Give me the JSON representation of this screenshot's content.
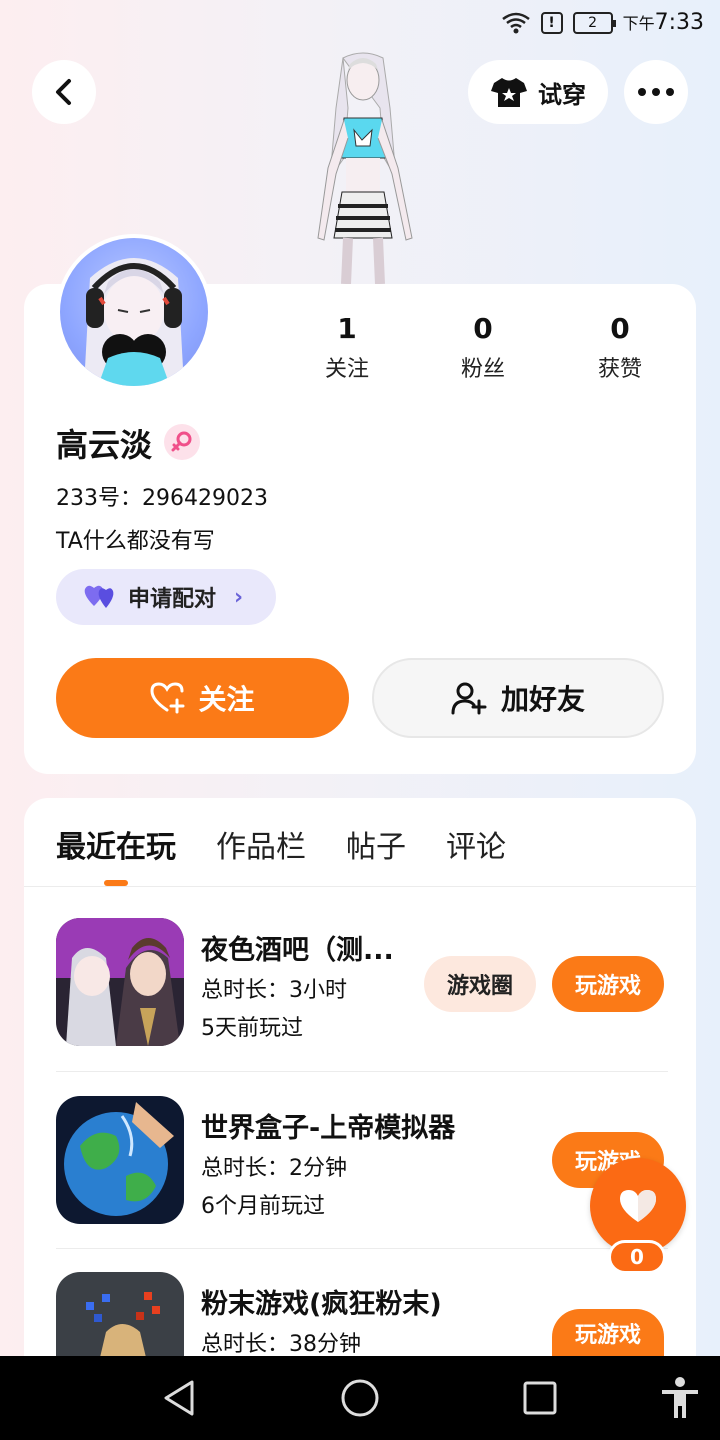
{
  "status_bar": {
    "time_prefix": "下午",
    "time": "7:33",
    "battery": "2"
  },
  "header": {
    "tryon_label": "试穿"
  },
  "profile": {
    "stats": [
      {
        "value": "1",
        "label": "关注"
      },
      {
        "value": "0",
        "label": "粉丝"
      },
      {
        "value": "0",
        "label": "获赞"
      }
    ],
    "username": "高云淡",
    "uid": "233号：296429023",
    "bio": "TA什么都没有写",
    "match_label": "申请配对",
    "follow_label": "关注",
    "add_friend_label": "加好友"
  },
  "tabs": [
    {
      "label": "最近在玩"
    },
    {
      "label": "作品栏"
    },
    {
      "label": "帖子"
    },
    {
      "label": "评论"
    }
  ],
  "games": [
    {
      "title": "夜色酒吧（测...",
      "duration": "总时长：3小时",
      "last_played": "5天前玩过",
      "circle_label": "游戏圈",
      "play_label": "玩游戏"
    },
    {
      "title": "世界盒子-上帝模拟器",
      "duration": "总时长：2分钟",
      "last_played": "6个月前玩过",
      "play_label": "玩游戏"
    },
    {
      "title": "粉末游戏(疯狂粉末)",
      "duration": "总时长：38分钟",
      "play_label": "玩游戏"
    }
  ],
  "like_fab": {
    "count": "0"
  },
  "colors": {
    "accent": "#fb7a17",
    "match_bg": "#e9e8fb",
    "circle_bg": "#fde8de"
  },
  "icons": [
    "back-icon",
    "tshirt-icon",
    "more-icon",
    "female-icon",
    "heart-pair-icon",
    "heart-plus-icon",
    "person-add-icon",
    "heart-icon",
    "nav-back-icon",
    "nav-home-icon",
    "nav-recents-icon",
    "accessibility-icon",
    "wifi-icon",
    "alert-icon",
    "battery-icon"
  ]
}
